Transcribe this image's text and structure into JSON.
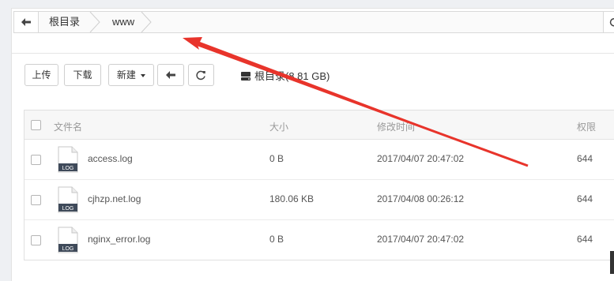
{
  "breadcrumb": {
    "items": [
      "根目录",
      "www"
    ]
  },
  "toolbar": {
    "upload": "上传",
    "download": "下载",
    "new": "新建",
    "disk_label": "根目录(8.81 GB)"
  },
  "table": {
    "headers": {
      "name": "文件名",
      "size": "大小",
      "modified": "修改时间",
      "perm": "权限"
    },
    "rows": [
      {
        "icon_text": "LOG",
        "name": "access.log",
        "size": "0 B",
        "modified": "2017/04/07 20:47:02",
        "perm": "644"
      },
      {
        "icon_text": "LOG",
        "name": "cjhzp.net.log",
        "size": "180.06 KB",
        "modified": "2017/04/08 00:26:12",
        "perm": "644"
      },
      {
        "icon_text": "LOG",
        "name": "nginx_error.log",
        "size": "0 B",
        "modified": "2017/04/07 20:47:02",
        "perm": "644"
      }
    ]
  },
  "annotation": {
    "color": "#e8342b",
    "icon": "arrow-pointer"
  }
}
